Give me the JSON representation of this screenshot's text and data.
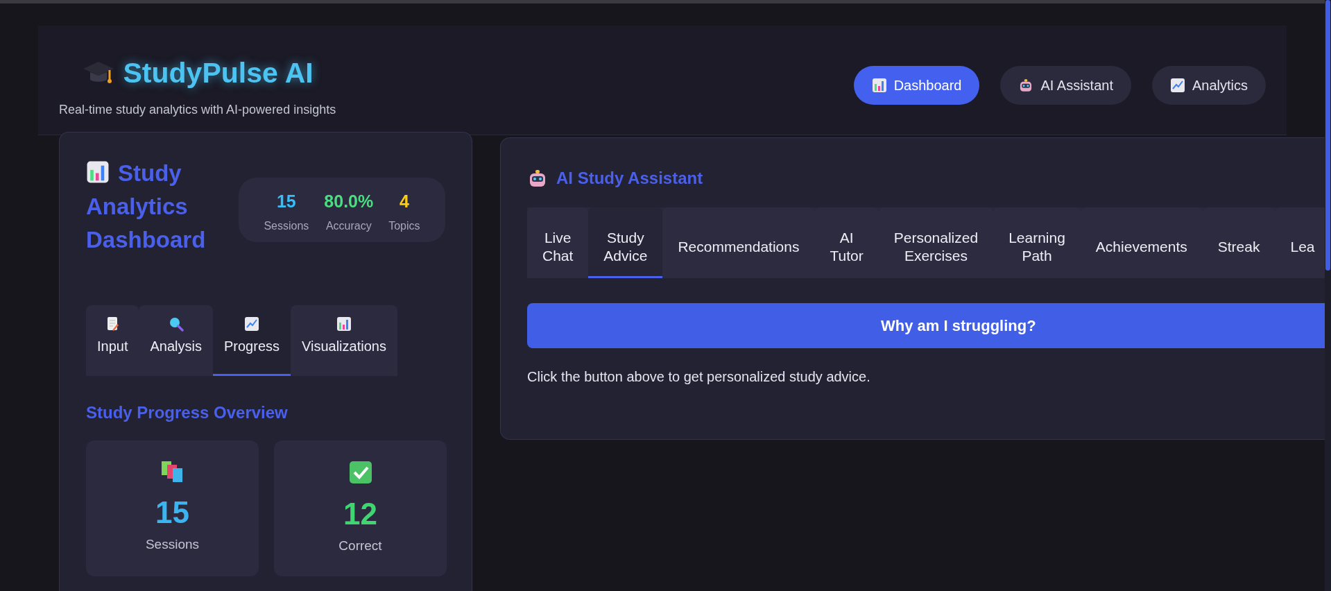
{
  "header": {
    "title": "StudyPulse AI",
    "subtitle": "Real-time study analytics with AI-powered insights",
    "nav": [
      {
        "label": "Dashboard",
        "selected": true
      },
      {
        "label": "AI Assistant",
        "selected": false
      },
      {
        "label": "Analytics",
        "selected": false
      }
    ]
  },
  "dashboard": {
    "title": "Study Analytics Dashboard",
    "stats": [
      {
        "value": "15",
        "label": "Sessions",
        "color": "#38bdf8"
      },
      {
        "value": "80.0%",
        "label": "Accuracy",
        "color": "#4ade80"
      },
      {
        "value": "4",
        "label": "Topics",
        "color": "#facc15"
      }
    ],
    "tabs": [
      {
        "label": "Input",
        "selected": false
      },
      {
        "label": "Analysis",
        "selected": false
      },
      {
        "label": "Progress",
        "selected": true
      },
      {
        "label": "Visualizations",
        "selected": false
      }
    ],
    "section_title": "Study Progress Overview",
    "cards": [
      {
        "value": "15",
        "label": "Sessions",
        "color": "#3bb4f0"
      },
      {
        "value": "12",
        "label": "Correct",
        "color": "#3fd672"
      }
    ]
  },
  "assistant": {
    "title": "AI Study Assistant",
    "tabs": [
      {
        "label": "Live Chat",
        "selected": false
      },
      {
        "label": "Study Advice",
        "selected": true
      },
      {
        "label": "Recommendations",
        "selected": false
      },
      {
        "label": "AI Tutor",
        "selected": false
      },
      {
        "label": "Personalized Exercises",
        "selected": false
      },
      {
        "label": "Learning Path",
        "selected": false
      },
      {
        "label": "Achievements",
        "selected": false
      },
      {
        "label": "Streak",
        "selected": false
      },
      {
        "label": "Lea",
        "selected": false
      }
    ],
    "button": "Why am I struggling?",
    "hint": "Click the button above to get personalized study advice."
  }
}
